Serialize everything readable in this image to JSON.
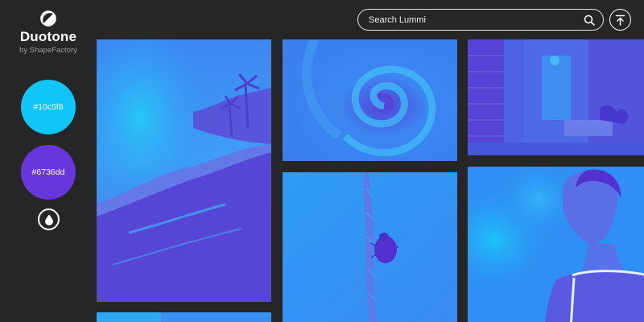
{
  "app": {
    "title": "Duotone",
    "subtitle": "by ShapeFactory",
    "logo_icon": "half-circle-logo-icon"
  },
  "colors": {
    "background": "#262626",
    "primary": "#10c5f8",
    "secondary": "#6736dd"
  },
  "swatches": [
    {
      "label": "#10c5f8",
      "color": "#10c5f8"
    },
    {
      "label": "#6736dd",
      "color": "#6736dd"
    }
  ],
  "actions": {
    "drop_icon": "water-drop-icon",
    "scroll_top_icon": "arrow-to-top-icon"
  },
  "search": {
    "placeholder": "Search Lummi",
    "value": "",
    "icon": "search-icon"
  },
  "gallery": [
    {
      "subject": "beach"
    },
    {
      "subject": "swirl"
    },
    {
      "subject": "hallway"
    },
    {
      "subject": "insect"
    },
    {
      "subject": "woman"
    },
    {
      "subject": "beach"
    }
  ]
}
